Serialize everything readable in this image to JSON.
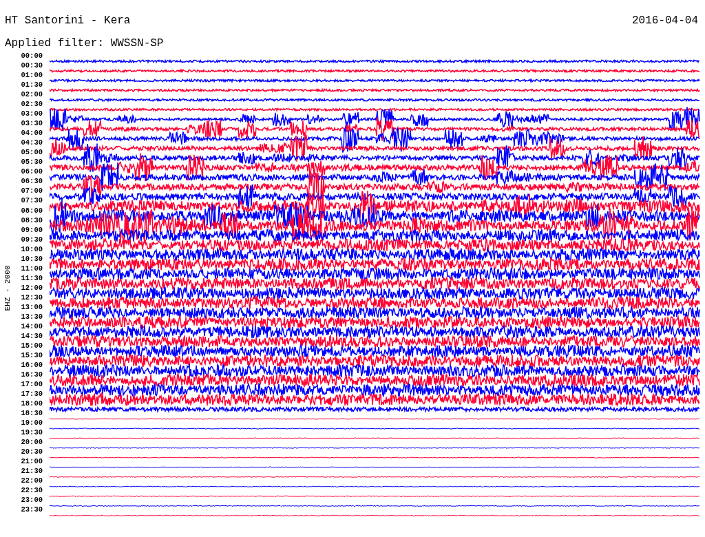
{
  "header": {
    "station": "HT Santorini - Kera",
    "date": "2016-04-04",
    "filter": "Applied filter: WWSSN-SP"
  },
  "helicorder": {
    "channel": "EHZ - 2000",
    "rows": [
      {
        "time": "00:00",
        "color": "#0000ff"
      },
      {
        "time": "00:30",
        "color": "#ff0033"
      },
      {
        "time": "01:00",
        "color": "#0000ff"
      },
      {
        "time": "01:30",
        "color": "#ff0033"
      },
      {
        "time": "02:00",
        "color": "#0000ff"
      },
      {
        "time": "02:30",
        "color": "#ff0033"
      },
      {
        "time": "03:00",
        "color": "#0000ff"
      },
      {
        "time": "03:30",
        "color": "#ff0033"
      },
      {
        "time": "04:00",
        "color": "#0000ff"
      },
      {
        "time": "04:30",
        "color": "#ff0033"
      },
      {
        "time": "05:00",
        "color": "#0000ff"
      },
      {
        "time": "05:30",
        "color": "#ff0033"
      },
      {
        "time": "06:00",
        "color": "#0000ff"
      },
      {
        "time": "06:30",
        "color": "#ff0033"
      },
      {
        "time": "07:00",
        "color": "#0000ff"
      },
      {
        "time": "07:30",
        "color": "#ff0033"
      },
      {
        "time": "08:00",
        "color": "#0000ff"
      },
      {
        "time": "08:30",
        "color": "#ff0033"
      },
      {
        "time": "09:00",
        "color": "#0000ff"
      },
      {
        "time": "09:30",
        "color": "#ff0033"
      },
      {
        "time": "10:00",
        "color": "#0000ff"
      },
      {
        "time": "10:30",
        "color": "#ff0033"
      },
      {
        "time": "11:00",
        "color": "#0000ff"
      },
      {
        "time": "11:30",
        "color": "#ff0033"
      },
      {
        "time": "12:00",
        "color": "#0000ff"
      },
      {
        "time": "12:30",
        "color": "#ff0033"
      },
      {
        "time": "13:00",
        "color": "#0000ff"
      },
      {
        "time": "13:30",
        "color": "#ff0033"
      },
      {
        "time": "14:00",
        "color": "#0000ff"
      },
      {
        "time": "14:30",
        "color": "#ff0033"
      },
      {
        "time": "15:00",
        "color": "#0000ff"
      },
      {
        "time": "15:30",
        "color": "#ff0033"
      },
      {
        "time": "16:00",
        "color": "#0000ff"
      },
      {
        "time": "16:30",
        "color": "#ff0033"
      },
      {
        "time": "17:00",
        "color": "#0000ff"
      },
      {
        "time": "17:30",
        "color": "#ff0033"
      },
      {
        "time": "18:00",
        "color": "#0000ff"
      },
      {
        "time": "18:30",
        "color": "#ff0033"
      },
      {
        "time": "19:00",
        "color": "#0000ff"
      },
      {
        "time": "19:30",
        "color": "#ff0033"
      },
      {
        "time": "20:00",
        "color": "#0000ff"
      },
      {
        "time": "20:30",
        "color": "#ff0033"
      },
      {
        "time": "21:00",
        "color": "#0000ff"
      },
      {
        "time": "21:30",
        "color": "#ff0033"
      },
      {
        "time": "22:00",
        "color": "#0000ff"
      },
      {
        "time": "22:30",
        "color": "#ff0033"
      },
      {
        "time": "23:00",
        "color": "#0000ff"
      },
      {
        "time": "23:30",
        "color": "#ff0033"
      }
    ]
  }
}
